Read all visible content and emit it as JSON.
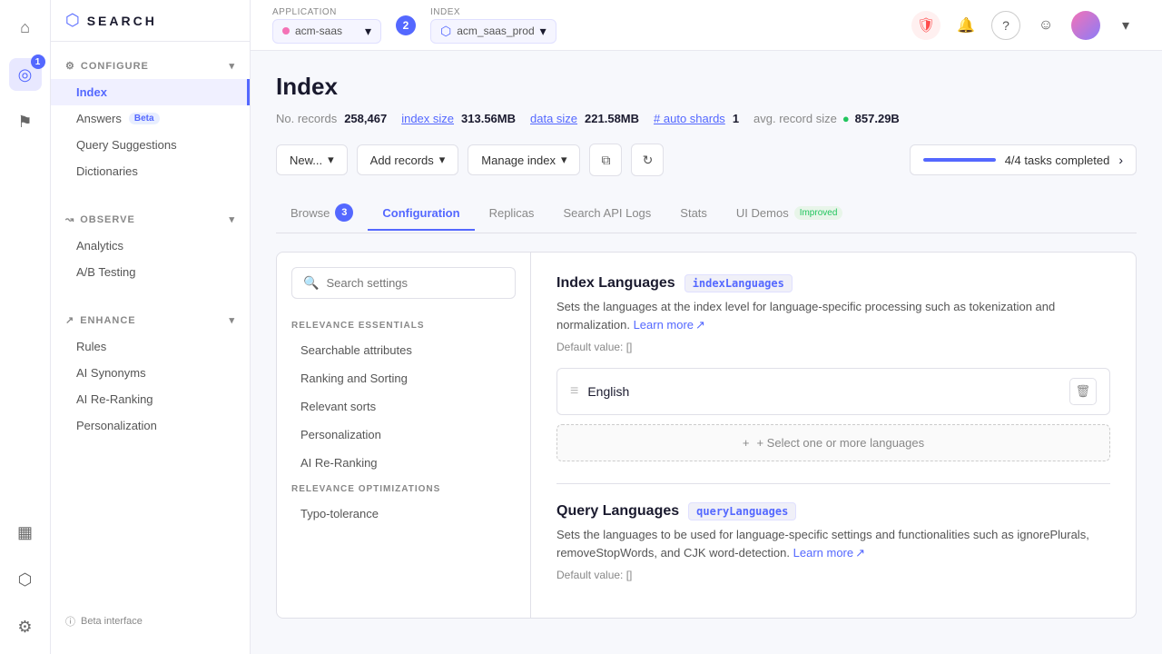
{
  "app": {
    "logo_text": "SEARCH",
    "logo_icon": "⬡"
  },
  "icon_bar": {
    "items": [
      {
        "id": "home",
        "icon": "⌂",
        "active": false
      },
      {
        "id": "search",
        "icon": "◎",
        "active": true,
        "badge": "1"
      },
      {
        "id": "pin",
        "icon": "⚑",
        "active": false
      }
    ],
    "bottom": [
      {
        "id": "chart",
        "icon": "▦",
        "active": false
      },
      {
        "id": "database",
        "icon": "⬡",
        "active": false
      },
      {
        "id": "settings",
        "icon": "⚙",
        "active": false
      }
    ]
  },
  "topnav": {
    "application_label": "Application",
    "index_label": "Index",
    "step_badge": "2",
    "app_name": "acm-saas",
    "index_name": "acm_saas_prod",
    "shield_icon": "🛡",
    "bell_icon": "🔔",
    "question_icon": "?",
    "smile_icon": "☺",
    "chevron_icon": "▾"
  },
  "sidebar": {
    "configure_label": "CONFIGURE",
    "configure_icon": "⚙",
    "items_configure": [
      {
        "id": "index",
        "label": "Index",
        "active": true
      },
      {
        "id": "answers",
        "label": "Answers",
        "badge": "Beta"
      },
      {
        "id": "query-suggestions",
        "label": "Query Suggestions"
      },
      {
        "id": "dictionaries",
        "label": "Dictionaries"
      }
    ],
    "observe_label": "OBSERVE",
    "items_observe": [
      {
        "id": "analytics",
        "label": "Analytics"
      },
      {
        "id": "ab-testing",
        "label": "A/B Testing"
      }
    ],
    "enhance_label": "ENHANCE",
    "items_enhance": [
      {
        "id": "rules",
        "label": "Rules"
      },
      {
        "id": "ai-synonyms",
        "label": "AI Synonyms"
      },
      {
        "id": "ai-re-ranking",
        "label": "AI Re-Ranking"
      },
      {
        "id": "personalization",
        "label": "Personalization"
      }
    ],
    "beta_interface_label": "Beta interface"
  },
  "page": {
    "title": "Index",
    "stats": {
      "no_records_label": "No. records",
      "no_records_value": "258,467",
      "index_size_label": "index size",
      "index_size_value": "313.56MB",
      "data_size_label": "data size",
      "data_size_value": "221.58MB",
      "auto_shards_label": "# auto shards",
      "auto_shards_value": "1",
      "avg_record_label": "avg. record size",
      "avg_record_value": "857.29B"
    },
    "toolbar": {
      "new_btn": "New...",
      "add_records_btn": "Add records",
      "manage_index_btn": "Manage index",
      "tasks_completed": "4/4 tasks completed",
      "tasks_progress": 100
    },
    "tabs": [
      {
        "id": "browse",
        "label": "Browse",
        "badge_num": "3"
      },
      {
        "id": "configuration",
        "label": "Configuration",
        "active": true
      },
      {
        "id": "replicas",
        "label": "Replicas"
      },
      {
        "id": "search-api-logs",
        "label": "Search API Logs"
      },
      {
        "id": "stats",
        "label": "Stats"
      },
      {
        "id": "ui-demos",
        "label": "UI Demos",
        "badge": "Improved"
      }
    ]
  },
  "config": {
    "search_placeholder": "Search settings",
    "sections": [
      {
        "header": "RELEVANCE ESSENTIALS",
        "items": [
          "Searchable attributes",
          "Ranking and Sorting",
          "Relevant sorts",
          "Personalization",
          "AI Re-Ranking"
        ]
      },
      {
        "header": "RELEVANCE OPTIMIZATIONS",
        "items": [
          "Typo-tolerance"
        ]
      }
    ],
    "right_panel": {
      "index_languages": {
        "title": "Index Languages",
        "code_tag": "indexLanguages",
        "description": "Sets the languages at the index level for language-specific processing such as tokenization and normalization.",
        "learn_more": "Learn more",
        "default_value": "Default value: []",
        "languages": [
          {
            "name": "English"
          }
        ],
        "add_btn": "+ Select one or more languages"
      },
      "query_languages": {
        "title": "Query Languages",
        "code_tag": "queryLanguages",
        "description": "Sets the languages to be used for language-specific settings and functionalities such as ignorePlurals, removeStopWords, and CJK word-detection.",
        "learn_more": "Learn more",
        "default_value": "Default value: []"
      }
    }
  }
}
